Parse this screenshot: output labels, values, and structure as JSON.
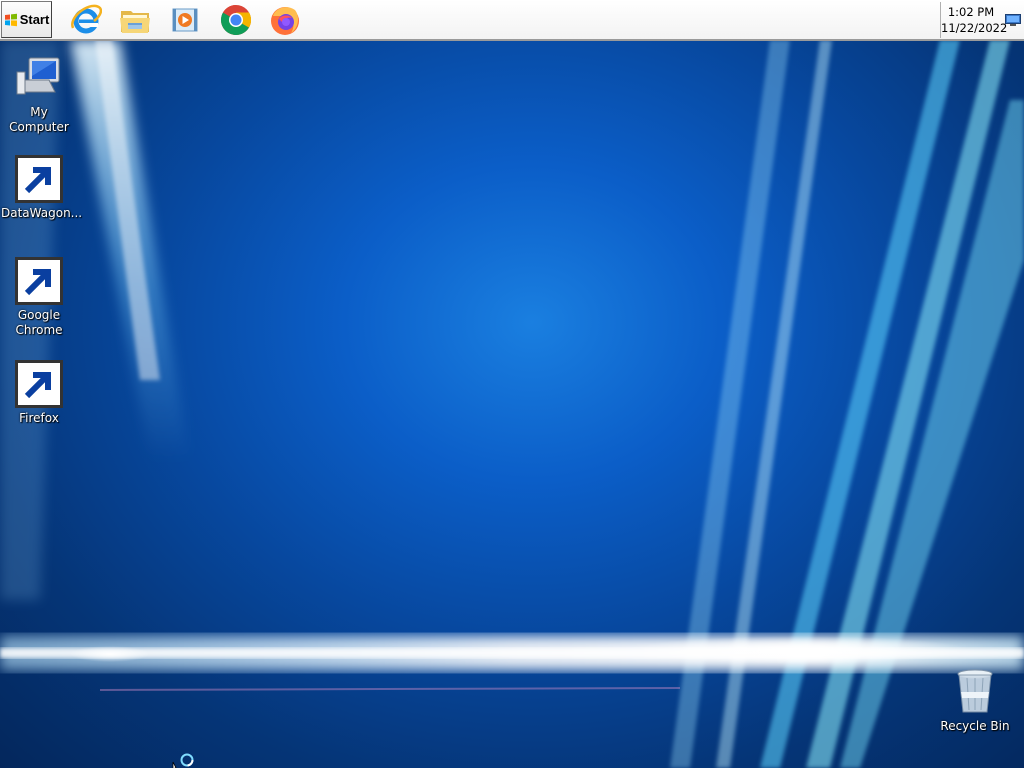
{
  "taskbar": {
    "start_label": "Start",
    "quick_launch": [
      {
        "name": "internet-explorer",
        "icon": "ie-icon"
      },
      {
        "name": "file-explorer",
        "icon": "folder-icon"
      },
      {
        "name": "media-player",
        "icon": "media-player-icon"
      },
      {
        "name": "google-chrome",
        "icon": "chrome-icon"
      },
      {
        "name": "firefox",
        "icon": "firefox-icon"
      }
    ],
    "tray": {
      "time": "1:02 PM",
      "date": "11/22/2022",
      "network_icon": "network-icon"
    }
  },
  "desktop": {
    "icons": [
      {
        "label": "My Computer",
        "icon": "computer-icon"
      },
      {
        "label": "DataWagon...",
        "icon": "datawagon-icon"
      },
      {
        "label": "Google Chrome",
        "icon": "chrome-icon"
      },
      {
        "label": "Firefox",
        "icon": "firefox-icon"
      },
      {
        "label": "Recycle Bin",
        "icon": "recycle-bin-icon"
      }
    ]
  },
  "colors": {
    "wallpaper_center": "#1a7fe0",
    "wallpaper_edge": "#04275c",
    "taskbar": "#ffffff"
  }
}
